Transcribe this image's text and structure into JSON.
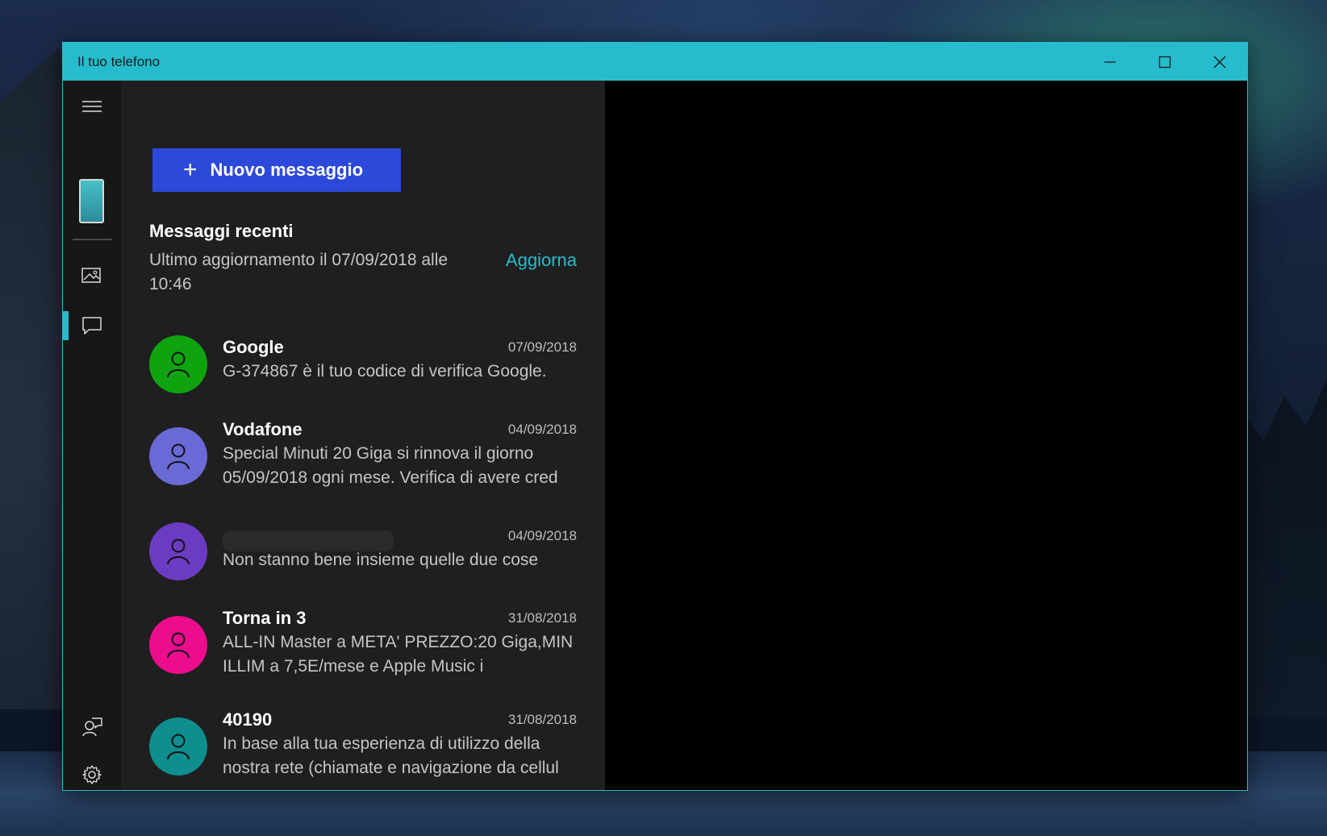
{
  "window": {
    "title": "Il tuo telefono"
  },
  "colors": {
    "accent": "#26bccd",
    "button": "#2d49d9"
  },
  "rail": {
    "items": [
      {
        "icon": "hamburger-menu-icon"
      },
      {
        "icon": "phone-icon"
      },
      {
        "icon": "photos-icon"
      },
      {
        "icon": "messages-icon",
        "active": true
      },
      {
        "icon": "feedback-icon"
      },
      {
        "icon": "settings-gear-icon"
      }
    ]
  },
  "panel": {
    "new_message_label": "Nuovo messaggio",
    "recent_title": "Messaggi recenti",
    "updated_text": "Ultimo aggiornamento il 07/09/2018 alle 10:46",
    "refresh_label": "Aggiorna"
  },
  "messages": [
    {
      "name": "Google",
      "date": "07/09/2018",
      "preview": "G-374867 è il tuo codice di verifica Google.",
      "avatar_color": "#10a310"
    },
    {
      "name": "Vodafone",
      "date": "04/09/2018",
      "preview": "Special Minuti 20 Giga si rinnova il giorno 05/09/2018 ogni mese. Verifica di avere cred",
      "avatar_color": "#6a6ad6"
    },
    {
      "name": "",
      "date": "04/09/2018",
      "preview": "Non stanno bene insieme quelle due cose",
      "avatar_color": "#6c3bc4"
    },
    {
      "name": "Torna in 3",
      "date": "31/08/2018",
      "preview": "ALL-IN Master a META' PREZZO:20 Giga,MIN ILLIM a 7,5E/mese e Apple Music i",
      "avatar_color": "#ec0d8e"
    },
    {
      "name": "40190",
      "date": "31/08/2018",
      "preview": "In base alla tua esperienza di utilizzo della nostra rete (chiamate e navigazione da cellul",
      "avatar_color": "#0e8e8e"
    }
  ]
}
